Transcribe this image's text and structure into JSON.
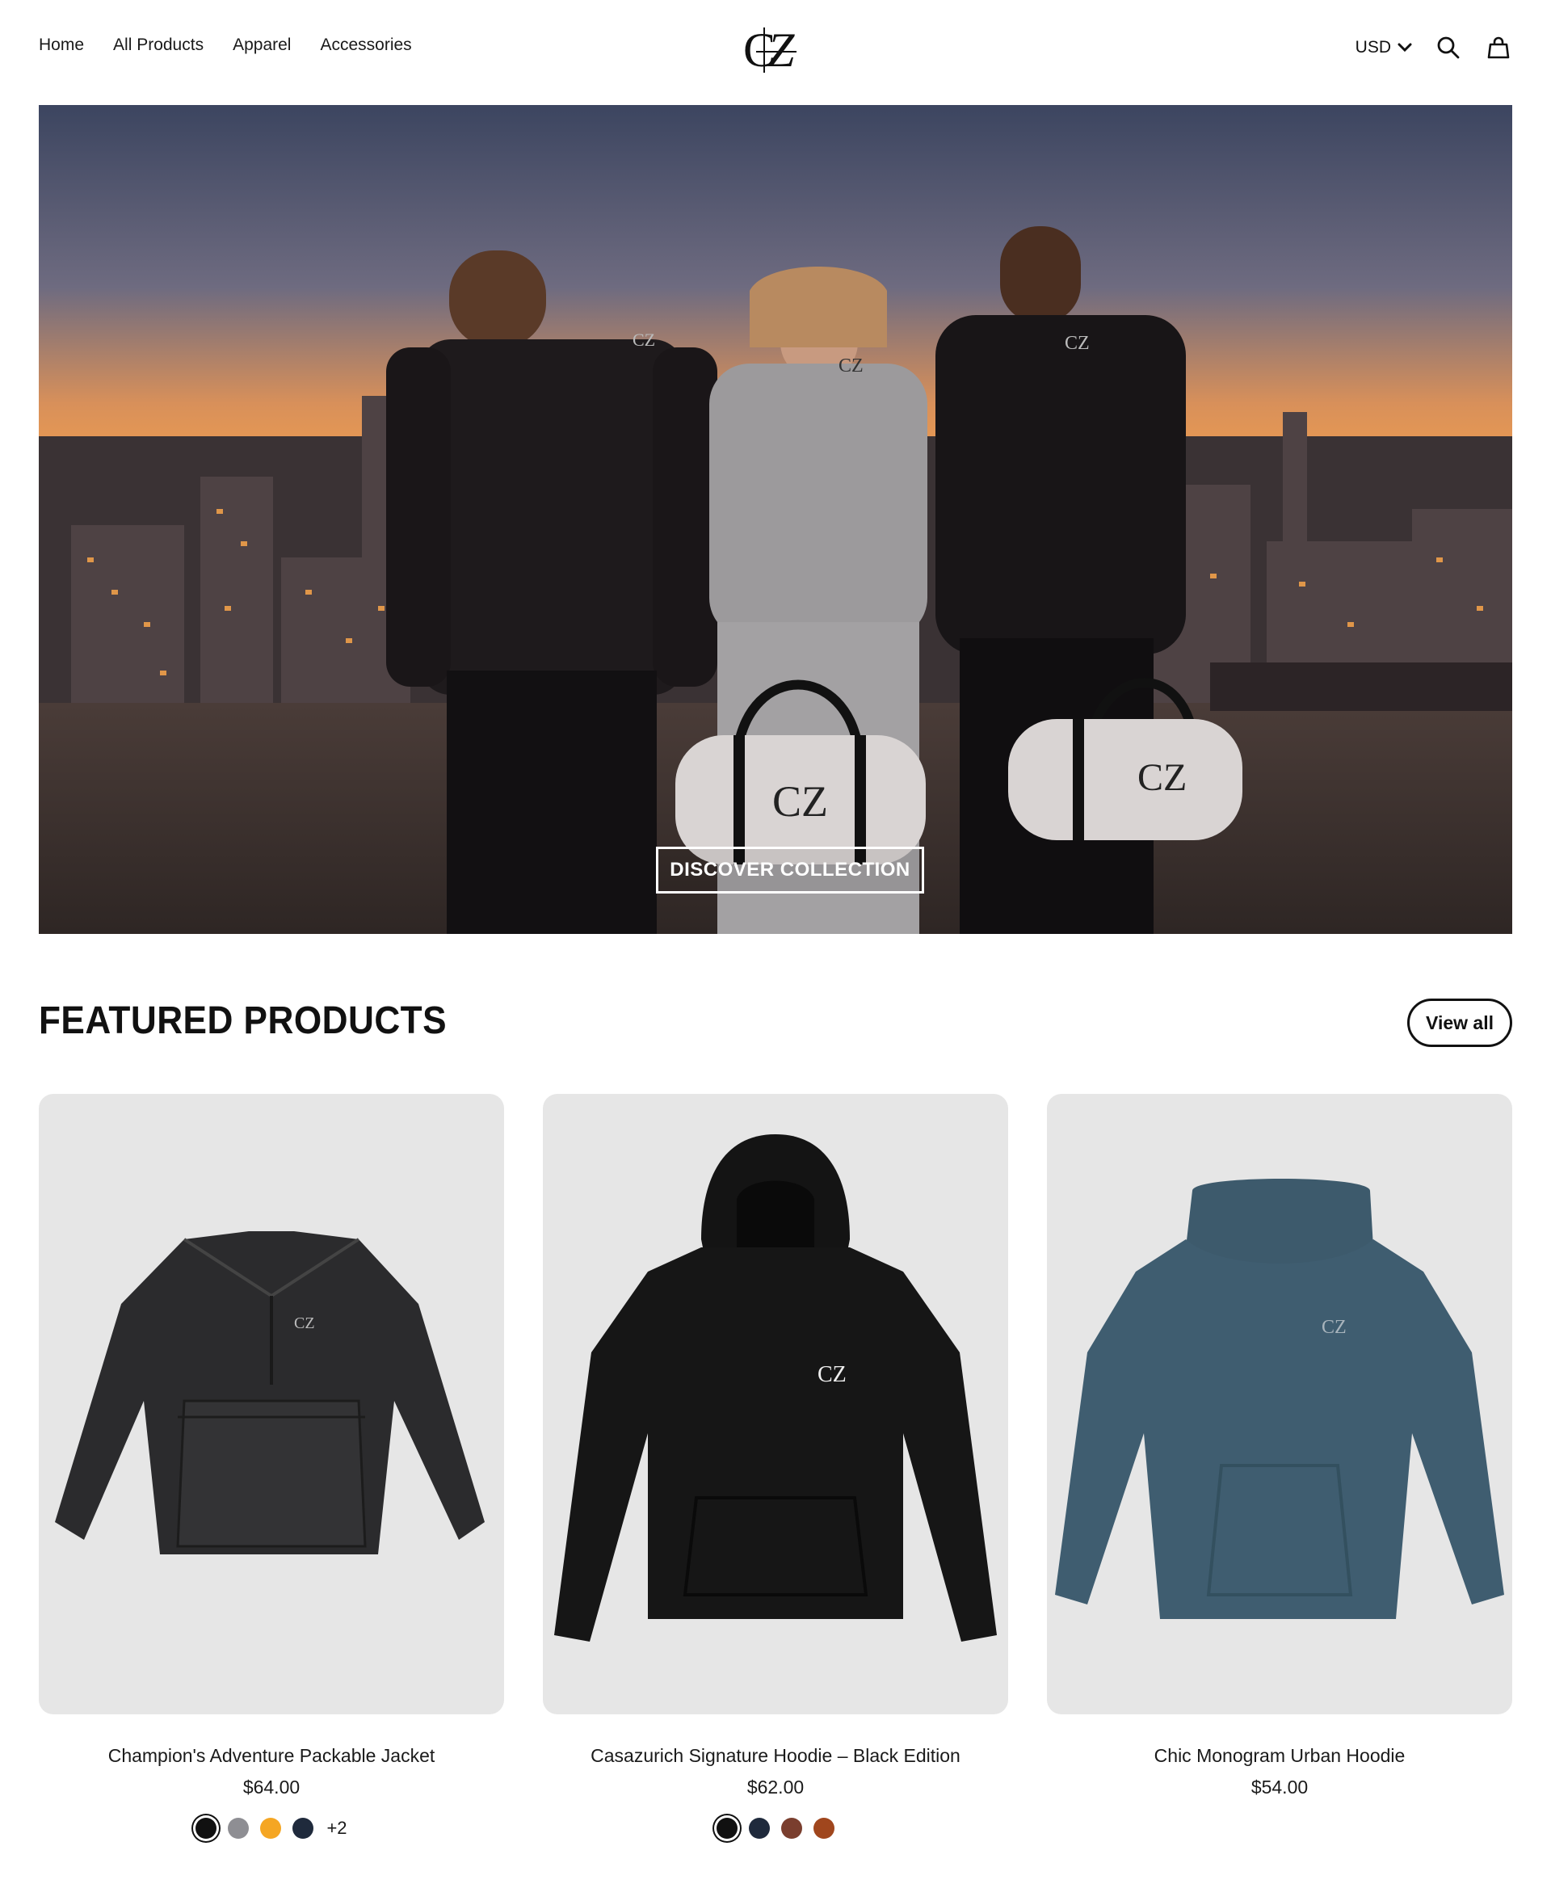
{
  "nav": {
    "items": [
      {
        "label": "Home"
      },
      {
        "label": "All Products"
      },
      {
        "label": "Apparel"
      },
      {
        "label": "Accessories"
      }
    ]
  },
  "header": {
    "logo_text": "CZ",
    "currency": "USD",
    "icons": [
      "chevron-down-icon",
      "search-icon",
      "cart-bag-icon"
    ]
  },
  "hero": {
    "cta_label": "DISCOVER COLLECTION",
    "brand_mark": "CZ"
  },
  "featured": {
    "title": "FEATURED PRODUCTS",
    "view_all_label": "View all",
    "products": [
      {
        "title": "Champion's Adventure Packable Jacket",
        "price": "$64.00",
        "swatches": [
          "#111111",
          "#8e8e93",
          "#f5a623",
          "#1f2a3c"
        ],
        "selected_swatch": 0,
        "more_colors": "+2"
      },
      {
        "title": "Casazurich Signature Hoodie – Black Edition",
        "price": "$62.00",
        "swatches": [
          "#111111",
          "#1f2a3c",
          "#7a3e2e",
          "#a0461d"
        ],
        "selected_swatch": 0,
        "more_colors": ""
      },
      {
        "title": "Chic Monogram Urban Hoodie",
        "price": "$54.00",
        "swatches": [],
        "selected_swatch": null,
        "more_colors": ""
      }
    ]
  },
  "colors": {
    "accent": "#111111",
    "card_bg": "#e6e6e6",
    "teal_hoodie": "#3f5d70"
  }
}
